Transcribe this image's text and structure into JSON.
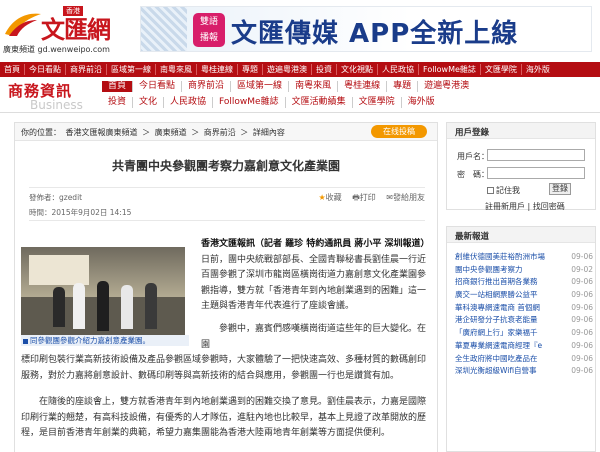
{
  "header": {
    "logo_text": "文匯網",
    "logo_tag": "香港",
    "logo_subtitle": "廣東頻道 gd.wenweipo.com",
    "banner": {
      "badge_line1": "雙語",
      "badge_line2": "播報",
      "text": "文匯傳媒 APP全新上線"
    }
  },
  "nav": {
    "items": [
      "首頁",
      "今日看點",
      "商界前沿",
      "區域第一線",
      "南粵來風",
      "粵桂連線",
      "專題",
      "遊遍粵港澳",
      "投資",
      "文化視點",
      "人民政協",
      "FollowMe雜誌",
      "文匯學院",
      "海外版"
    ]
  },
  "section": {
    "title": "商務資訊",
    "eng": "Business",
    "row1": [
      "首頁",
      "今日看點",
      "商界前沿",
      "區域第一線",
      "南粵來風",
      "粵桂連線",
      "專題",
      "遊遍粵港澳"
    ],
    "row2": [
      "投資",
      "文化",
      "人民政協",
      "FollowMe雜誌",
      "文匯活動績集",
      "文匯學院",
      "海外版"
    ]
  },
  "article": {
    "breadcrumb": [
      "你的位置：",
      "香港文匯報廣東頻道",
      "＞",
      "廣東頻道",
      "＞",
      "商界前沿",
      "＞",
      "詳細內容"
    ],
    "collect_label": "在线投稿",
    "title": "共青團中央參觀團考察力嘉創意文化產業園",
    "author": "發佈者：gzedit",
    "time": "時間：2015年9月02日 14:15",
    "actions": [
      "收藏",
      "打印",
      "發給朋友"
    ],
    "photo_caption": "同參觀團參觀介紹力嘉創意產業園。",
    "lead_bold": "香港文匯報訊（記者 羅珍 特約通訊員 蔣小平 深圳報道）",
    "lead_text": "日前，團中央統戰部部長、全國青聯秘書長劉佳晨一行近百團參觀了深圳市龍崗區橫崗街道力嘉創意文化產業園參觀指導，雙方就「香港青年到內地創業遇到的困難」這一主題與香港青年代表進行了座談會議。",
    "para2_a": "參觀中，嘉賓們感嘆橫崗街道這些年的巨大變化。在園",
    "para2_b": "標印刷包裝行業高新技術設備及產品參觀區域參觀時，大家體驗了一把快速高效、多種材質的數碼創印服務，對於力嘉將創意設計、數碼印刷等與高新技術的結合與應用，參觀團一行也是讚賞有加。",
    "para3": "在隨後的座談會上，雙方就香港青年到內地創業遇到的困難交換了意見。劉佳晨表示，力嘉是國際印刷行業的翹楚，有高科技設備，有優秀的人才隊伍，進駐內地也比較早，基本上見證了改革開放的歷程，是目前香港青年創業的典範，希望力嘉集團能為香港大陸兩地青年創業等方面提供便利。"
  },
  "sidebar": {
    "login": {
      "title": "用戶登錄",
      "username_label": "用戶名：",
      "password_label": "密　碼：",
      "remember_label": "記住我",
      "login_button": "登錄",
      "register_links": "註冊新用戶 | 找回密碼"
    },
    "news": {
      "title": "最新報道",
      "items": [
        {
          "title": "創維伏德國美莊裕酌洲市場",
          "date": "09-06"
        },
        {
          "title": "團中央參觀團考察力",
          "date": "09-02"
        },
        {
          "title": "招商銀行推出首期各業務",
          "date": "09-06"
        },
        {
          "title": "廣交一站相網票勝公益平",
          "date": "09-06"
        },
        {
          "title": "華科澳專網速電商 首個網",
          "date": "09-06"
        },
        {
          "title": "港企研發分子抗衰老能量",
          "date": "09-06"
        },
        {
          "title": "「廣府網上行」家樂福千",
          "date": "09-06"
        },
        {
          "title": "華夏專業網速電商經理『e",
          "date": "09-06"
        },
        {
          "title": "全生政府將中國吃產品在",
          "date": "09-06"
        },
        {
          "title": "深圳光衡超級Wifi自營事",
          "date": "09-06"
        }
      ]
    }
  }
}
